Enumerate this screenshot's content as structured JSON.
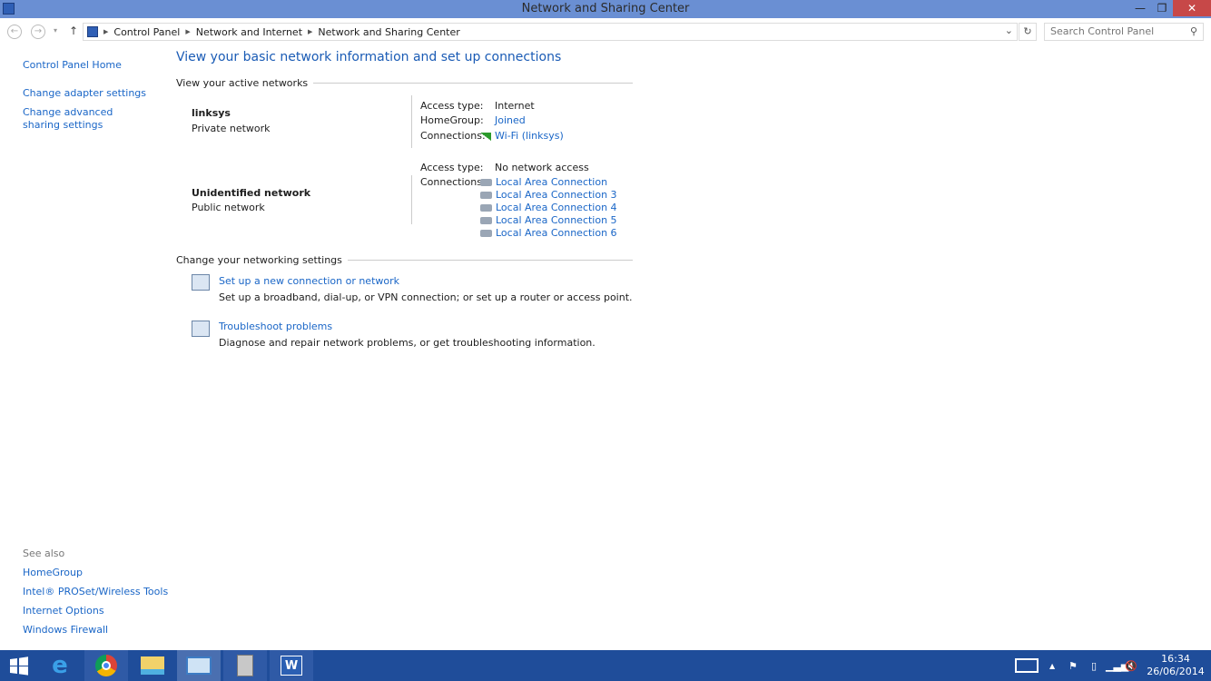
{
  "window": {
    "title": "Network and Sharing Center",
    "minimize": "—",
    "maximize": "❐",
    "close": "✕"
  },
  "nav": {
    "back": "←",
    "forward": "→",
    "recent": "▾",
    "up": "↑",
    "breadcrumb": [
      "Control Panel",
      "Network and Internet",
      "Network and Sharing Center"
    ],
    "dropdown": "⌄",
    "refresh": "↻",
    "search_placeholder": "Search Control Panel",
    "search_icon": "⚲"
  },
  "sidebar": {
    "items": [
      "Control Panel Home",
      "Change adapter settings",
      "Change advanced sharing settings"
    ],
    "see_also_label": "See also",
    "see_also": [
      "HomeGroup",
      "Intel® PROSet/Wireless Tools",
      "Internet Options",
      "Windows Firewall"
    ]
  },
  "main": {
    "title": "View your basic network information and set up connections",
    "active_networks_label": "View your active networks",
    "networks": [
      {
        "name": "linksys",
        "type": "Private network",
        "access_label": "Access type:",
        "access": "Internet",
        "homegroup_label": "HomeGroup:",
        "homegroup": "Joined",
        "connections_label": "Connections:",
        "connections": [
          "Wi-Fi (linksys)"
        ]
      },
      {
        "name": "Unidentified network",
        "type": "Public network",
        "access_label": "Access type:",
        "access": "No network access",
        "connections_label": "Connections:",
        "connections": [
          "Local Area Connection",
          "Local Area Connection 3",
          "Local Area Connection 4",
          "Local Area Connection 5",
          "Local Area Connection 6"
        ]
      }
    ],
    "change_settings_label": "Change your networking settings",
    "tasks": [
      {
        "link": "Set up a new connection or network",
        "desc": "Set up a broadband, dial-up, or VPN connection; or set up a router or access point."
      },
      {
        "link": "Troubleshoot problems",
        "desc": "Diagnose and repair network problems, or get troubleshooting information."
      }
    ]
  },
  "taskbar": {
    "apps": [
      "start",
      "internet-explorer",
      "chrome",
      "file-explorer",
      "control-panel",
      "device-manager",
      "word"
    ],
    "time": "16:34",
    "date": "26/06/2014"
  },
  "colors": {
    "titlebar": "#6a8fd3",
    "taskbar": "#1f4d9a",
    "link": "#1a66c7",
    "close": "#c74848"
  }
}
